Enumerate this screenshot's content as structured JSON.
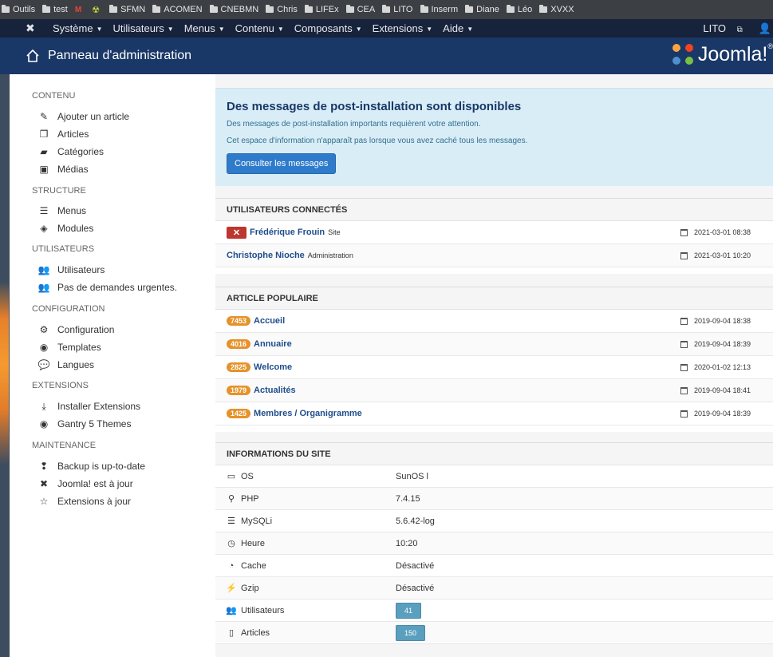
{
  "bookmarks": [
    "Outils",
    "test",
    "SFMN",
    "ACOMEN",
    "CNEBMN",
    "Chris",
    "LIFEx",
    "CEA",
    "LITO",
    "Inserm",
    "Diane",
    "Léo",
    "XVXX"
  ],
  "topnav": {
    "menus": [
      "Système",
      "Utilisateurs",
      "Menus",
      "Contenu",
      "Composants",
      "Extensions",
      "Aide"
    ],
    "site_link": "LITO"
  },
  "header": {
    "title": "Panneau d'administration",
    "brand": "Joomla!",
    "brand_mark": "®"
  },
  "sidebar": {
    "sections": [
      {
        "title": "CONTENU",
        "items": [
          {
            "label": "Ajouter un article",
            "icon": "pencil-icon"
          },
          {
            "label": "Articles",
            "icon": "copy-icon"
          },
          {
            "label": "Catégories",
            "icon": "folder-icon"
          },
          {
            "label": "Médias",
            "icon": "image-icon"
          }
        ]
      },
      {
        "title": "STRUCTURE",
        "items": [
          {
            "label": "Menus",
            "icon": "list-icon"
          },
          {
            "label": "Modules",
            "icon": "cube-icon"
          }
        ]
      },
      {
        "title": "UTILISATEURS",
        "items": [
          {
            "label": "Utilisateurs",
            "icon": "users-icon"
          },
          {
            "label": "Pas de demandes urgentes.",
            "icon": "users-icon"
          }
        ]
      },
      {
        "title": "CONFIGURATION",
        "items": [
          {
            "label": "Configuration",
            "icon": "cog-icon"
          },
          {
            "label": "Templates",
            "icon": "eye-icon"
          },
          {
            "label": "Langues",
            "icon": "comments-icon"
          }
        ]
      },
      {
        "title": "EXTENSIONS",
        "items": [
          {
            "label": "Installer Extensions",
            "icon": "download-icon"
          },
          {
            "label": "Gantry 5 Themes",
            "icon": "eye-icon"
          }
        ]
      },
      {
        "title": "MAINTENANCE",
        "items": [
          {
            "label": "Backup is up-to-date",
            "icon": "backup-icon"
          },
          {
            "label": "Joomla! est à jour",
            "icon": "joomla-icon"
          },
          {
            "label": "Extensions à jour",
            "icon": "star-icon"
          }
        ]
      }
    ]
  },
  "alert": {
    "title": "Des messages de post-installation sont disponibles",
    "line1": "Des messages de post-installation importants requièrent votre attention.",
    "line2": "Cet espace d'information n'apparaît pas lorsque vous avez caché tous les messages.",
    "button": "Consulter les messages"
  },
  "logged_users": {
    "title": "UTILISATEURS CONNECTÉS",
    "rows": [
      {
        "name": "Frédérique Frouin",
        "where": "Site",
        "date": "2021-03-01 08:38",
        "logout": "✕"
      },
      {
        "name": "Christophe Nioche",
        "where": "Administration",
        "date": "2021-03-01 10:20"
      }
    ]
  },
  "popular": {
    "title": "ARTICLE POPULAIRE",
    "rows": [
      {
        "hits": "7453",
        "name": "Accueil",
        "date": "2019-09-04 18:38"
      },
      {
        "hits": "4016",
        "name": "Annuaire",
        "date": "2019-09-04 18:39"
      },
      {
        "hits": "2825",
        "name": "Welcome",
        "date": "2020-01-02 12:13"
      },
      {
        "hits": "1979",
        "name": "Actualités",
        "date": "2019-09-04 18:41"
      },
      {
        "hits": "1425",
        "name": "Membres / Organigramme",
        "date": "2019-09-04 18:39"
      }
    ]
  },
  "siteinfo": {
    "title": "INFORMATIONS DU SITE",
    "rows": [
      {
        "label": "OS",
        "value": "SunOS l",
        "icon": "monitor-icon"
      },
      {
        "label": "PHP",
        "value": "7.4.15",
        "icon": "php-icon"
      },
      {
        "label": "MySQLi",
        "value": "5.6.42-log",
        "icon": "database-icon"
      },
      {
        "label": "Heure",
        "value": "10:20",
        "icon": "clock-icon"
      },
      {
        "label": "Cache",
        "value": "Désactivé",
        "icon": "cache-icon"
      },
      {
        "label": "Gzip",
        "value": "Désactivé",
        "icon": "bolt-icon"
      },
      {
        "label": "Utilisateurs",
        "value": "41",
        "icon": "users-icon",
        "badge": true
      },
      {
        "label": "Articles",
        "value": "150",
        "icon": "file-icon",
        "badge": true
      }
    ]
  },
  "colors": {
    "topnav": "#17223b",
    "header": "#1a3867",
    "alert_bg": "#d9edf7",
    "primary_button": "#2f7bcb",
    "hits_badge": "#e6922a",
    "logout_button": "#bd362f",
    "count_badge": "#5b9fbf"
  }
}
